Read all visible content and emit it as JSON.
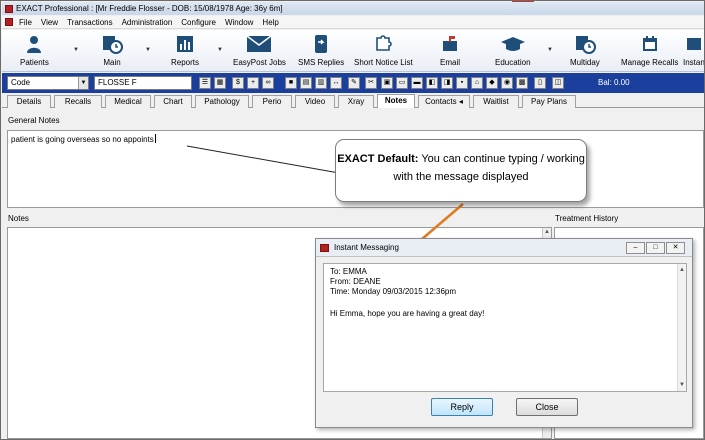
{
  "window": {
    "title": "EXACT Professional : [Mr Freddie Flosser - DOB: 15/08/1978 Age: 36y 6m]"
  },
  "menu": {
    "items": [
      "File",
      "View",
      "Transactions",
      "Administration",
      "Configure",
      "Window",
      "Help"
    ]
  },
  "toolbar": {
    "patients": "Patients",
    "main": "Main",
    "reports": "Reports",
    "easypost": "EasyPost Jobs",
    "sms": "SMS Replies",
    "short_notice": "Short Notice List",
    "email": "Email",
    "education": "Education",
    "multiday": "Multiday",
    "manage_recalls": "Manage Recalls",
    "instant": "Instan"
  },
  "codebar": {
    "code_value": "Code",
    "patient_value": "FLOSSE F",
    "balance": "Bal: 0.00"
  },
  "tabs": [
    "Details",
    "Recalls",
    "Medical",
    "Chart",
    "Pathology",
    "Perio",
    "Video",
    "Xray",
    "Notes",
    "Contacts",
    "Waitlist",
    "Pay Plans"
  ],
  "general_notes": {
    "label": "General Notes",
    "text": "patient is going overseas so no appoints"
  },
  "notes": {
    "label": "Notes"
  },
  "treatment_history": {
    "label": "Treatment History"
  },
  "callout": {
    "bold": "EXACT Default:",
    "text": " You can continue typing / working with the message displayed"
  },
  "im": {
    "title": "Instant Messaging",
    "to": "To: EMMA",
    "from": "From: DEANE",
    "time": "Time: Monday 09/03/2015 12:36pm",
    "message": "Hi Emma, hope you are having a great day!",
    "reply": "Reply",
    "close": "Close"
  },
  "colors": {
    "codebar": "#1a3f9c",
    "arrow": "#e07b20"
  }
}
